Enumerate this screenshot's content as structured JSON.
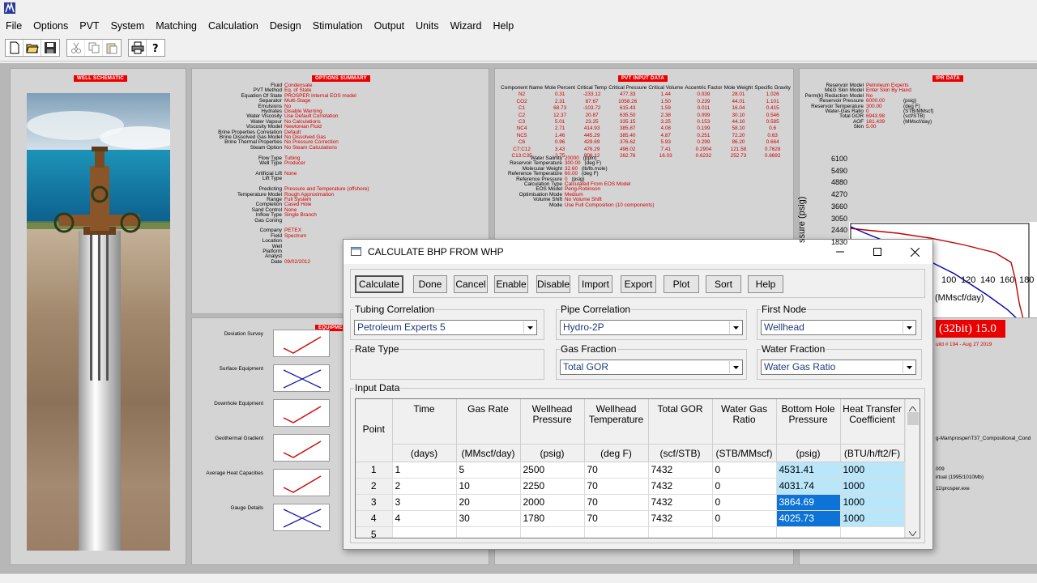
{
  "menu": [
    "File",
    "Options",
    "PVT",
    "System",
    "Matching",
    "Calculation",
    "Design",
    "Stimulation",
    "Output",
    "Units",
    "Wizard",
    "Help"
  ],
  "toolbar_icons": [
    "new-file-icon",
    "open-folder-icon",
    "save-disk-icon",
    "cut-icon",
    "copy-icon",
    "paste-icon",
    "print-icon",
    "help-question-icon"
  ],
  "panels": {
    "well_schematic": {
      "title": "WELL SCHEMATIC"
    },
    "options_summary": {
      "title": "OPTIONS SUMMARY",
      "rows": [
        {
          "k": "Fluid",
          "v": "Condensate"
        },
        {
          "k": "PVT Method",
          "v": "Eq. of State"
        },
        {
          "k": "Equation Of State",
          "v": "PROSPER Internal EOS model"
        },
        {
          "k": "Separator",
          "v": "Multi-Stage"
        },
        {
          "k": "Emulsions",
          "v": "No"
        },
        {
          "k": "Hydrates",
          "v": "Disable Warning"
        },
        {
          "k": "Water Viscosity",
          "v": "Use Default Correlation"
        },
        {
          "k": "Water Vapour",
          "v": "No Calculations"
        },
        {
          "k": "Viscosity Model",
          "v": "Newtonian Fluid"
        },
        {
          "k": "Brine Properties Correlation",
          "v": "Default"
        },
        {
          "k": "Brine Dissolved Gas Model",
          "v": "No Dissolved Gas"
        },
        {
          "k": "Brine Thermal Properties",
          "v": "No Pressure Correction"
        },
        {
          "k": "Steam Option",
          "v": "No Steam Calculations"
        },
        {
          "k": "",
          "v": ""
        },
        {
          "k": "Flow Type",
          "v": "Tubing"
        },
        {
          "k": "Well Type",
          "v": "Producer"
        },
        {
          "k": "",
          "v": ""
        },
        {
          "k": "Artificial Lift",
          "v": "None"
        },
        {
          "k": "Lift Type",
          "v": ""
        },
        {
          "k": "",
          "v": ""
        },
        {
          "k": "Predicting",
          "v": "Pressure and Temperature (offshore)"
        },
        {
          "k": "Temperature Model",
          "v": "Rough Approximation"
        },
        {
          "k": "Range",
          "v": "Full System"
        },
        {
          "k": "Completion",
          "v": "Cased Hole"
        },
        {
          "k": "Sand Control",
          "v": "None"
        },
        {
          "k": "Inflow Type",
          "v": "Single Branch"
        },
        {
          "k": "Gas Coning",
          "v": ""
        },
        {
          "k": "",
          "v": ""
        },
        {
          "k": "Company",
          "v": "PETEX"
        },
        {
          "k": "Field",
          "v": "Spectrum"
        },
        {
          "k": "Location",
          "v": ""
        },
        {
          "k": "Well",
          "v": ""
        },
        {
          "k": "Platform",
          "v": ""
        },
        {
          "k": "Analyst",
          "v": ""
        },
        {
          "k": "Date",
          "v": "09/02/2012"
        }
      ]
    },
    "pvt_input": {
      "title": "PVT INPUT DATA",
      "headers": [
        "Component Name",
        "Mole Percent",
        "Critical Temp",
        "Critical Pressure",
        "Critical Volume",
        "Accentric Factor",
        "Mole Weight",
        "Specific Gravity"
      ],
      "rows": [
        [
          "N2",
          "0.31",
          "-233.12",
          "477.33",
          "1.44",
          "0.039",
          "28.01",
          "1.026"
        ],
        [
          "CO2",
          "2.31",
          "87.67",
          "1058.26",
          "1.50",
          "0.239",
          "44.01",
          "1.101"
        ],
        [
          "C1",
          "68.73",
          "-103.72",
          "615.43",
          "1.59",
          "0.011",
          "16.04",
          "0.415"
        ],
        [
          "C2",
          "12.37",
          "20.87",
          "635.50",
          "2.38",
          "0.099",
          "30.10",
          "0.546"
        ],
        [
          "C3",
          "5.01",
          "23.25",
          "335.15",
          "3.25",
          "0.153",
          "44.10",
          "0.585"
        ],
        [
          "NC4",
          "2.71",
          "414.93",
          "385.87",
          "4.08",
          "0.199",
          "58.10",
          "0.6"
        ],
        [
          "NC5",
          "1.46",
          "445.29",
          "385.40",
          "4.87",
          "0.251",
          "72.20",
          "0.63"
        ],
        [
          "C6",
          "0.96",
          "429.69",
          "376.62",
          "5.93",
          "0.299",
          "86.20",
          "0.664"
        ],
        [
          "C7:C12",
          "3.43",
          "476.29",
          "496.02",
          "7.41",
          "0.2904",
          "121.58",
          "0.7628"
        ],
        [
          "C13:C35",
          "2.75",
          "906.12",
          "262.76",
          "16.03",
          "0.6232",
          "252.73",
          "0.8692"
        ]
      ],
      "props": [
        {
          "k": "Water Salinity",
          "v": "20000",
          "u": "(ppm)"
        },
        {
          "k": "Reservoir Temperature",
          "v": "300.00",
          "u": "(deg F)"
        },
        {
          "k": "Molecular Weight",
          "v": "32.60",
          "u": "(lb/lb.mole)"
        },
        {
          "k": "Reference Temperature",
          "v": "60.00",
          "u": "(deg F)"
        },
        {
          "k": "Reference Pressure",
          "v": "0",
          "u": "(psig)"
        },
        {
          "k": "Calculation Type",
          "v": "Calculated From EOS Model",
          "u": ""
        },
        {
          "k": "EOS Model",
          "v": "Peng-Robinson",
          "u": ""
        },
        {
          "k": "Optimisation Mode",
          "v": "Medium",
          "u": ""
        },
        {
          "k": "Volume Shift",
          "v": "No Volume Shift",
          "u": ""
        },
        {
          "k": "Mode",
          "v": "Use Full Composition (10 components)",
          "u": ""
        }
      ]
    },
    "ipr": {
      "title": "IPR DATA",
      "rows": [
        {
          "k": "Reservoir Model",
          "v": "Petroleum Experts"
        },
        {
          "k": "M&G Skin Model",
          "v": "Enter Skin By Hand"
        },
        {
          "k": "Perm(k) Reduction Model",
          "v": "No"
        },
        {
          "k": "Reservoir Pressure",
          "v": "6000.00",
          "u": "(psig)"
        },
        {
          "k": "Reservoir Temperature",
          "v": "300.00",
          "u": "(deg F)"
        },
        {
          "k": "Water-Gas Ratio",
          "v": "0",
          "u": "(STB/MMscf)"
        },
        {
          "k": "Total GOR",
          "v": "6943.98",
          "u": "(scf/STB)"
        },
        {
          "k": "AOF",
          "v": "181.439",
          "u": "(MMscf/day)"
        },
        {
          "k": "Skin",
          "v": "5.00"
        }
      ],
      "ylabel": "ssure  (psig)",
      "xlabel": "(MMscf/day)",
      "x_ticks": [
        "100",
        "120",
        "140",
        "160",
        "180"
      ],
      "y_ticks": [
        "6100",
        "5490",
        "4880",
        "4270",
        "3660",
        "3050",
        "2440",
        "1830"
      ]
    },
    "equipment": {
      "title": "EQUIPMENT",
      "items": [
        {
          "label": "Deviation Survey",
          "state": "ok"
        },
        {
          "label": "Surface Equipment",
          "state": "cross"
        },
        {
          "label": "Downhole Equipment",
          "state": "ok"
        },
        {
          "label": "Geothermal Gradient",
          "state": "ok"
        },
        {
          "label": "Average Heat Capacities",
          "state": "ok"
        },
        {
          "label": "Gauge Details",
          "state": "cross"
        }
      ]
    },
    "version": {
      "banner": "(32bit) 15.0",
      "build": "uild # 194 - Aug 27 2019",
      "lines": [
        "g-Man\\prosper\\T37_Compositional_Cond",
        "009",
        "irtual (1995/1010Mb)",
        "11\\prosper.exe"
      ]
    }
  },
  "dialog": {
    "title": "CALCULATE BHP FROM WHP",
    "buttons": [
      "Calculate",
      "Done",
      "Cancel",
      "Enable",
      "Disable",
      "Import",
      "Export",
      "Plot",
      "Sort",
      "Help"
    ],
    "tubing_correlation": {
      "label": "Tubing Correlation",
      "value": "Petroleum Experts 5"
    },
    "pipe_correlation": {
      "label": "Pipe Correlation",
      "value": "Hydro-2P"
    },
    "first_node": {
      "label": "First Node",
      "value": "Wellhead"
    },
    "rate_type": {
      "label": "Rate Type"
    },
    "gas_fraction": {
      "label": "Gas Fraction",
      "value": "Total GOR"
    },
    "water_fraction": {
      "label": "Water Fraction",
      "value": "Water Gas Ratio"
    },
    "input_data": {
      "label": "Input Data",
      "point_header": "Point",
      "columns": [
        {
          "name": "Time",
          "unit": "(days)"
        },
        {
          "name": "Gas Rate",
          "unit": "(MMscf/day)"
        },
        {
          "name": "Wellhead Pressure",
          "unit": "(psig)"
        },
        {
          "name": "Wellhead Temperature",
          "unit": "(deg F)"
        },
        {
          "name": "Total GOR",
          "unit": "(scf/STB)"
        },
        {
          "name": "Water Gas Ratio",
          "unit": "(STB/MMscf)"
        },
        {
          "name": "Bottom Hole Pressure",
          "unit": "(psig)"
        },
        {
          "name": "Heat Transfer Coefficient",
          "unit": "(BTU/h/ft2/F)"
        }
      ],
      "rows": [
        {
          "point": "1",
          "cells": [
            "1",
            "5",
            "2500",
            "70",
            "7432",
            "0",
            "4531.41",
            "1000"
          ]
        },
        {
          "point": "2",
          "cells": [
            "2",
            "10",
            "2250",
            "70",
            "7432",
            "0",
            "4031.74",
            "1000"
          ]
        },
        {
          "point": "3",
          "cells": [
            "3",
            "20",
            "2000",
            "70",
            "7432",
            "0",
            "3864.69",
            "1000"
          ]
        },
        {
          "point": "4",
          "cells": [
            "4",
            "30",
            "1780",
            "70",
            "7432",
            "0",
            "4025.73",
            "1000"
          ]
        },
        {
          "point": "5",
          "cells": [
            "",
            "",
            "",
            "",
            "",
            "",
            "",
            ""
          ]
        }
      ]
    }
  }
}
